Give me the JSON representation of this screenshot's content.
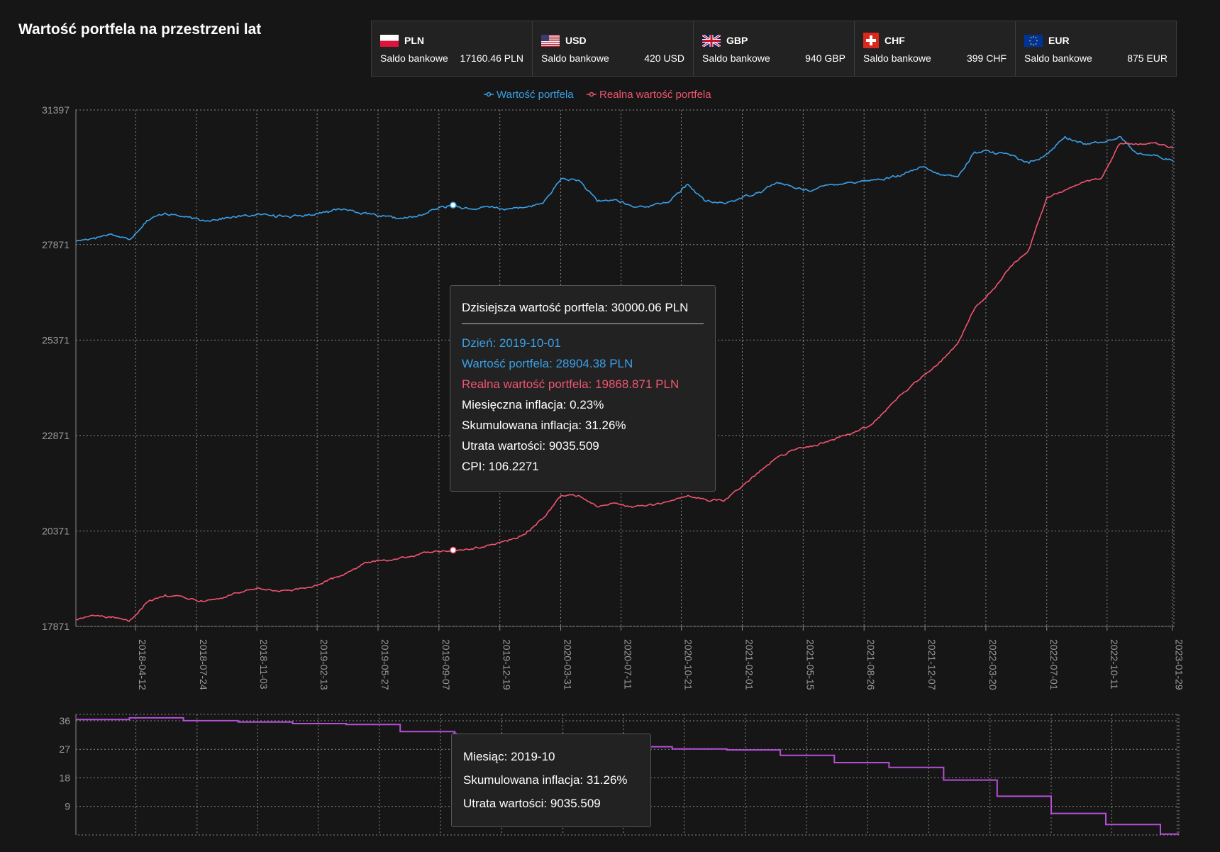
{
  "page_title": "Wartość portfela na przestrzeni lat",
  "currencies": [
    {
      "code": "PLN",
      "flag_icon": "poland-flag-icon",
      "label": "Saldo bankowe",
      "value": "17160.46 PLN"
    },
    {
      "code": "USD",
      "flag_icon": "usa-flag-icon",
      "label": "Saldo bankowe",
      "value": "420 USD"
    },
    {
      "code": "GBP",
      "flag_icon": "uk-flag-icon",
      "label": "Saldo bankowe",
      "value": "940 GBP"
    },
    {
      "code": "CHF",
      "flag_icon": "switzerland-flag-icon",
      "label": "Saldo bankowe",
      "value": "399 CHF"
    },
    {
      "code": "EUR",
      "flag_icon": "eu-flag-icon",
      "label": "Saldo bankowe",
      "value": "875 EUR"
    }
  ],
  "colors": {
    "portfolio": "#3aa0e8",
    "real": "#f05570",
    "inflation": "#b44fd6",
    "grid": "#8a8a8a",
    "axis_text": "#9a9a9a"
  },
  "tooltip_main": {
    "today_label": "Dzisiejsza wartość portfela:",
    "today_value": "30000.06 PLN",
    "day_label": "Dzień:",
    "day_value": "2019-10-01",
    "portfolio_label": "Wartość portfela:",
    "portfolio_value": "28904.38 PLN",
    "real_label": "Realna wartość portfela:",
    "real_value": "19868.871 PLN",
    "monthly_inflation_label": "Miesięczna inflacja:",
    "monthly_inflation_value": "0.23%",
    "cum_inflation_label": "Skumulowana inflacja:",
    "cum_inflation_value": "31.26%",
    "loss_label": "Utrata wartości:",
    "loss_value": "9035.509",
    "cpi_label": "CPI:",
    "cpi_value": "106.2271"
  },
  "tooltip_inflation": {
    "month_label": "Miesiąc:",
    "month_value": "2019-10",
    "cum_inflation_label": "Skumulowana inflacja:",
    "cum_inflation_value": "31.26%",
    "loss_label": "Utrata wartości:",
    "loss_value": "9035.509"
  },
  "chart_data": [
    {
      "type": "line",
      "title": "",
      "legend_position": "top-center",
      "grid": true,
      "ylim": [
        17871,
        31397
      ],
      "y_ticks": [
        17871,
        20371,
        22871,
        25371,
        27871,
        31397
      ],
      "x_range": [
        "2018-01-01",
        "2023-02-01"
      ],
      "x_ticks": [
        "2018-04-12",
        "2018-07-24",
        "2018-11-03",
        "2019-02-13",
        "2019-05-27",
        "2019-09-07",
        "2019-12-19",
        "2020-03-31",
        "2020-07-11",
        "2020-10-21",
        "2021-02-01",
        "2021-05-15",
        "2021-08-26",
        "2021-12-07",
        "2022-03-20",
        "2022-07-01",
        "2022-10-11",
        "2023-01-29"
      ],
      "highlight_x": "2019-10-01",
      "series": [
        {
          "name": "Wartość portfela",
          "points": [
            [
              "2018-01-01",
              27960
            ],
            [
              "2018-02-01",
              28050
            ],
            [
              "2018-03-01",
              28150
            ],
            [
              "2018-04-01",
              28000
            ],
            [
              "2018-05-01",
              28500
            ],
            [
              "2018-06-01",
              28700
            ],
            [
              "2018-07-01",
              28600
            ],
            [
              "2018-08-01",
              28500
            ],
            [
              "2018-09-01",
              28550
            ],
            [
              "2018-10-01",
              28600
            ],
            [
              "2018-11-01",
              28650
            ],
            [
              "2018-12-01",
              28650
            ],
            [
              "2019-01-01",
              28600
            ],
            [
              "2019-02-01",
              28650
            ],
            [
              "2019-03-01",
              28750
            ],
            [
              "2019-04-01",
              28800
            ],
            [
              "2019-05-01",
              28700
            ],
            [
              "2019-06-01",
              28600
            ],
            [
              "2019-07-01",
              28550
            ],
            [
              "2019-08-01",
              28600
            ],
            [
              "2019-09-01",
              28800
            ],
            [
              "2019-10-01",
              28904
            ],
            [
              "2019-11-01",
              28800
            ],
            [
              "2019-12-01",
              28850
            ],
            [
              "2020-01-01",
              28800
            ],
            [
              "2020-02-01",
              28850
            ],
            [
              "2020-03-01",
              28950
            ],
            [
              "2020-04-01",
              29600
            ],
            [
              "2020-05-01",
              29550
            ],
            [
              "2020-06-01",
              29000
            ],
            [
              "2020-07-01",
              29050
            ],
            [
              "2020-08-01",
              28850
            ],
            [
              "2020-09-01",
              28900
            ],
            [
              "2020-10-01",
              29000
            ],
            [
              "2020-11-01",
              29450
            ],
            [
              "2020-12-01",
              29000
            ],
            [
              "2021-01-01",
              28950
            ],
            [
              "2021-02-01",
              29100
            ],
            [
              "2021-03-01",
              29250
            ],
            [
              "2021-04-01",
              29500
            ],
            [
              "2021-05-01",
              29350
            ],
            [
              "2021-06-01",
              29300
            ],
            [
              "2021-07-01",
              29450
            ],
            [
              "2021-08-01",
              29500
            ],
            [
              "2021-09-01",
              29550
            ],
            [
              "2021-10-01",
              29600
            ],
            [
              "2021-11-01",
              29700
            ],
            [
              "2021-12-01",
              29900
            ],
            [
              "2022-01-01",
              29700
            ],
            [
              "2022-02-01",
              29650
            ],
            [
              "2022-03-01",
              30300
            ],
            [
              "2022-04-01",
              30300
            ],
            [
              "2022-05-01",
              30200
            ],
            [
              "2022-06-01",
              30000
            ],
            [
              "2022-07-01",
              30250
            ],
            [
              "2022-08-01",
              30700
            ],
            [
              "2022-09-01",
              30500
            ],
            [
              "2022-10-01",
              30550
            ],
            [
              "2022-11-01",
              30700
            ],
            [
              "2022-12-01",
              30250
            ],
            [
              "2023-01-01",
              30200
            ],
            [
              "2023-01-31",
              30050
            ]
          ]
        },
        {
          "name": "Realna wartość portfela",
          "points": [
            [
              "2018-01-01",
              18060
            ],
            [
              "2018-02-01",
              18150
            ],
            [
              "2018-03-01",
              18100
            ],
            [
              "2018-04-01",
              18000
            ],
            [
              "2018-05-01",
              18500
            ],
            [
              "2018-06-01",
              18700
            ],
            [
              "2018-07-01",
              18650
            ],
            [
              "2018-08-01",
              18550
            ],
            [
              "2018-09-01",
              18600
            ],
            [
              "2018-10-01",
              18750
            ],
            [
              "2018-11-01",
              18850
            ],
            [
              "2018-12-01",
              18800
            ],
            [
              "2019-01-01",
              18800
            ],
            [
              "2019-02-01",
              18900
            ],
            [
              "2019-03-01",
              19050
            ],
            [
              "2019-04-01",
              19250
            ],
            [
              "2019-05-01",
              19500
            ],
            [
              "2019-06-01",
              19600
            ],
            [
              "2019-07-01",
              19650
            ],
            [
              "2019-08-01",
              19750
            ],
            [
              "2019-09-01",
              19850
            ],
            [
              "2019-10-01",
              19869
            ],
            [
              "2019-11-01",
              19900
            ],
            [
              "2019-12-01",
              20000
            ],
            [
              "2020-01-01",
              20100
            ],
            [
              "2020-02-01",
              20300
            ],
            [
              "2020-03-01",
              20700
            ],
            [
              "2020-04-01",
              21300
            ],
            [
              "2020-05-01",
              21300
            ],
            [
              "2020-06-01",
              21000
            ],
            [
              "2020-07-01",
              21100
            ],
            [
              "2020-08-01",
              21000
            ],
            [
              "2020-09-01",
              21050
            ],
            [
              "2020-10-01",
              21150
            ],
            [
              "2020-11-01",
              21300
            ],
            [
              "2020-12-01",
              21200
            ],
            [
              "2021-01-01",
              21150
            ],
            [
              "2021-02-01",
              21550
            ],
            [
              "2021-03-01",
              21900
            ],
            [
              "2021-04-01",
              22300
            ],
            [
              "2021-05-01",
              22500
            ],
            [
              "2021-06-01",
              22600
            ],
            [
              "2021-07-01",
              22750
            ],
            [
              "2021-08-01",
              22900
            ],
            [
              "2021-09-01",
              23100
            ],
            [
              "2021-10-01",
              23500
            ],
            [
              "2021-11-01",
              24000
            ],
            [
              "2021-12-01",
              24400
            ],
            [
              "2022-01-01",
              24800
            ],
            [
              "2022-02-01",
              25300
            ],
            [
              "2022-03-01",
              26200
            ],
            [
              "2022-04-01",
              26700
            ],
            [
              "2022-05-01",
              27300
            ],
            [
              "2022-06-01",
              27750
            ],
            [
              "2022-07-01",
              29100
            ],
            [
              "2022-08-01",
              29300
            ],
            [
              "2022-09-01",
              29500
            ],
            [
              "2022-10-01",
              29600
            ],
            [
              "2022-11-01",
              30500
            ],
            [
              "2022-12-01",
              30500
            ],
            [
              "2023-01-01",
              30550
            ],
            [
              "2023-01-31",
              30400
            ]
          ]
        }
      ]
    },
    {
      "type": "line",
      "title": "",
      "grid": true,
      "ylim": [
        0,
        38
      ],
      "y_ticks": [
        9,
        18,
        27,
        36
      ],
      "x_range": [
        "2018-01-01",
        "2023-02-01"
      ],
      "highlight_x": "2019-10-01",
      "series": [
        {
          "name": "",
          "step": true,
          "points": [
            [
              "2018-01-01",
              36.4
            ],
            [
              "2018-04-01",
              36.9
            ],
            [
              "2018-07-01",
              36.0
            ],
            [
              "2018-10-01",
              35.6
            ],
            [
              "2019-01-01",
              35.1
            ],
            [
              "2019-04-01",
              34.8
            ],
            [
              "2019-07-01",
              32.6
            ],
            [
              "2019-10-01",
              31.26
            ],
            [
              "2020-01-01",
              30.3
            ],
            [
              "2020-04-01",
              28.6
            ],
            [
              "2020-07-01",
              27.8
            ],
            [
              "2020-10-01",
              27.1
            ],
            [
              "2021-01-01",
              26.8
            ],
            [
              "2021-04-01",
              25.1
            ],
            [
              "2021-07-01",
              22.8
            ],
            [
              "2021-10-01",
              21.3
            ],
            [
              "2022-01-01",
              17.3
            ],
            [
              "2022-04-01",
              12.2
            ],
            [
              "2022-07-01",
              6.8
            ],
            [
              "2022-10-01",
              3.3
            ],
            [
              "2023-01-01",
              0.3
            ],
            [
              "2023-01-31",
              0.0
            ]
          ]
        }
      ]
    }
  ]
}
